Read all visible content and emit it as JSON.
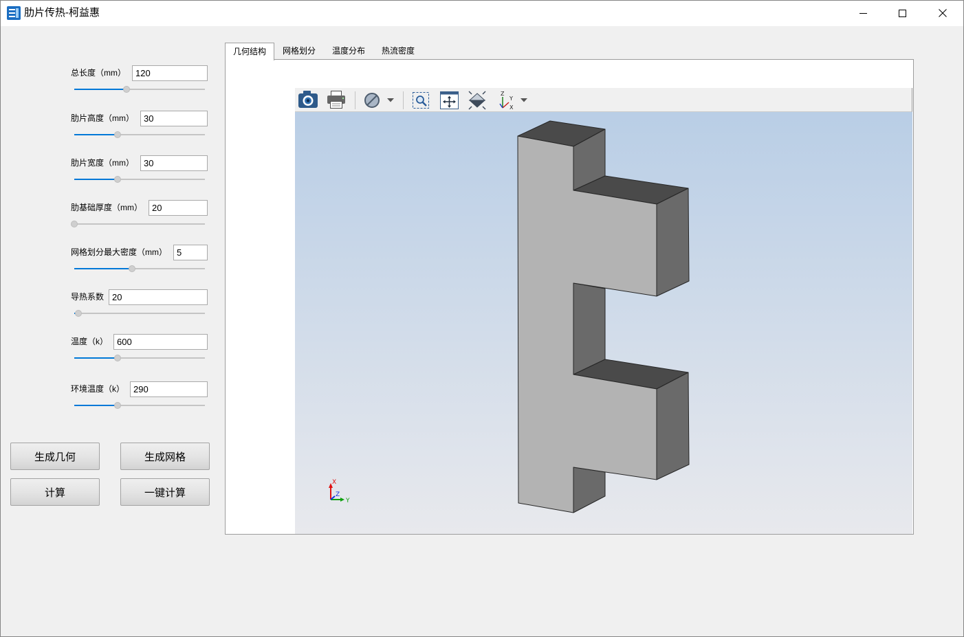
{
  "window": {
    "title": "肋片传热-柯益惠",
    "icon": "app-icon",
    "controls": [
      "minimize-icon",
      "maximize-icon",
      "close-icon"
    ]
  },
  "params": [
    {
      "label": "总长度（mm）",
      "value": "120",
      "slider": 0.4
    },
    {
      "label": "肋片高度（mm）",
      "value": "30",
      "slider": 0.33
    },
    {
      "label": "肋片宽度（mm）",
      "value": "30",
      "slider": 0.33
    },
    {
      "label": "肋基础厚度（mm）",
      "value": "20",
      "slider": 0.0
    },
    {
      "label": "网格划分最大密度（mm）",
      "value": "5",
      "slider": 0.44
    },
    {
      "label": "导热系数",
      "value": "20",
      "slider": 0.03
    },
    {
      "label": "温度（k）",
      "value": "600",
      "slider": 0.33
    },
    {
      "label": "环境温度（k）",
      "value": "290",
      "slider": 0.33
    }
  ],
  "buttons": {
    "generate_geometry": "生成几何",
    "generate_mesh": "生成网格",
    "compute": "计算",
    "one_click_compute": "一键计算"
  },
  "tabs": [
    {
      "label": "几何结构",
      "active": true
    },
    {
      "label": "网格划分",
      "active": false
    },
    {
      "label": "温度分布",
      "active": false
    },
    {
      "label": "热流密度",
      "active": false
    }
  ],
  "viewer": {
    "toolbar": [
      "camera-icon",
      "printer-icon",
      "shading-mode-icon",
      "chevron-down-icon",
      "zoom-box-icon",
      "fit-all-icon",
      "view-fit-icon",
      "axis-view-icon",
      "chevron-down-icon"
    ],
    "axis_icon_labels": {
      "z": "Z",
      "y": "Y",
      "x": "X"
    },
    "triad": {
      "x": "X",
      "y": "Y",
      "z": "Z"
    },
    "background": {
      "top": "#b9cee6",
      "bottom": "#e8e9ed"
    },
    "model_colors": {
      "front": "#b3b3b3",
      "top": "#4a4a4a",
      "side": "#6a6a6a",
      "edge": "#262626"
    }
  },
  "colors": {
    "accent": "#0078d7",
    "slider_track": "#c4c4c4",
    "window_bg": "#f0f0f0"
  }
}
